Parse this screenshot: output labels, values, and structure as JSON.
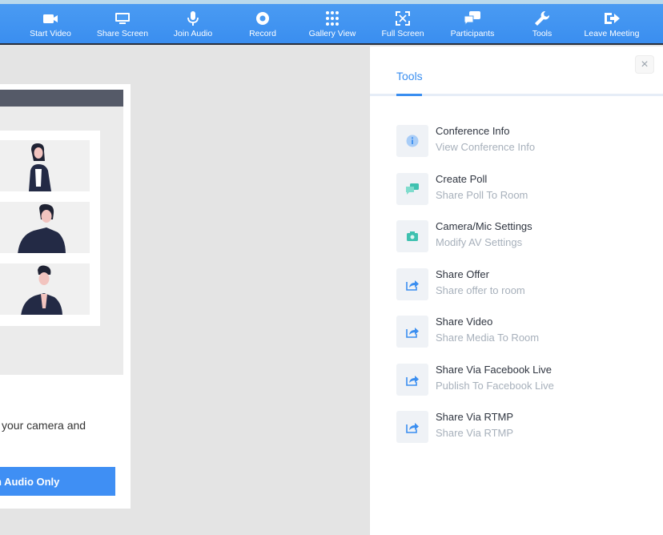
{
  "toolbar": {
    "buttons": [
      {
        "label": "Start Video",
        "icon": "video-camera-icon"
      },
      {
        "label": "Share Screen",
        "icon": "monitor-icon"
      },
      {
        "label": "Join Audio",
        "icon": "microphone-icon"
      },
      {
        "label": "Record",
        "icon": "record-icon"
      },
      {
        "label": "Gallery View",
        "icon": "grid-icon"
      },
      {
        "label": "Full Screen",
        "icon": "fullscreen-icon"
      },
      {
        "label": "Participants",
        "icon": "participants-icon"
      },
      {
        "label": "Tools",
        "icon": "wrench-icon"
      },
      {
        "label": "Leave Meeting",
        "icon": "leave-icon"
      }
    ]
  },
  "stage": {
    "message": "your camera and",
    "audio_only_button": "n Audio Only"
  },
  "panel": {
    "close": "×",
    "tab_label": "Tools",
    "items": [
      {
        "title": "Conference Info",
        "subtitle": "View Conference Info",
        "icon": "info-icon"
      },
      {
        "title": "Create Poll",
        "subtitle": "Share Poll To Room",
        "icon": "poll-chat-icon"
      },
      {
        "title": "Camera/Mic Settings",
        "subtitle": "Modify AV Settings",
        "icon": "camera-icon"
      },
      {
        "title": "Share Offer",
        "subtitle": "Share offer to room",
        "icon": "share-arrow-icon"
      },
      {
        "title": "Share Video",
        "subtitle": "Share Media To Room",
        "icon": "share-arrow-icon"
      },
      {
        "title": "Share Via Facebook Live",
        "subtitle": "Publish To Facebook Live",
        "icon": "share-arrow-icon"
      },
      {
        "title": "Share Via RTMP",
        "subtitle": "Share Via RTMP",
        "icon": "share-arrow-icon"
      }
    ]
  },
  "colors": {
    "toolbar": "#3a8ef0",
    "accent": "#3a8ef0",
    "teal_icon": "#3fc1b0"
  }
}
